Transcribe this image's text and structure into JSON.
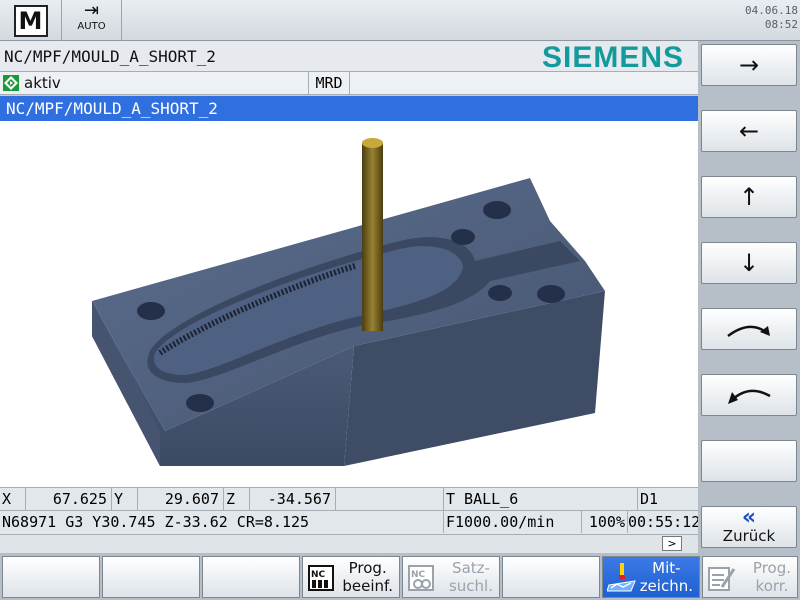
{
  "header": {
    "mode_jog_label": "M",
    "mode_auto_label": "AUTO",
    "date": "04.06.18",
    "time": "08:52"
  },
  "program": {
    "path": "NC/MPF/MOULD_A_SHORT_2",
    "brand": "SIEMENS",
    "status": "aktiv",
    "mrd": "MRD",
    "title": "NC/MPF/MOULD_A_SHORT_2"
  },
  "positions": {
    "x_label": "X",
    "x_value": "67.625",
    "y_label": "Y",
    "y_value": "29.607",
    "z_label": "Z",
    "z_value": "-34.567",
    "tool": "T BALL_6",
    "d": "D1"
  },
  "nc_line": {
    "block": "N68971 G3 Y30.745 Z-33.62 CR=8.125",
    "feed": "F1000.00/min",
    "override": "100%",
    "runtime": "00:55:12"
  },
  "scroll_glyph": ">",
  "right_softkeys": [
    {
      "label": "→"
    },
    {
      "label": "←"
    },
    {
      "label": "↑"
    },
    {
      "label": "↓"
    },
    {
      "label": ""
    },
    {
      "label": ""
    },
    {
      "label": ""
    },
    {
      "label": "«",
      "sub": "Zurück"
    }
  ],
  "bottom_softkeys": [
    {
      "l1": "",
      "l2": ""
    },
    {
      "l1": "",
      "l2": ""
    },
    {
      "l1": "",
      "l2": ""
    },
    {
      "l1": "Prog.",
      "l2": "beeinf."
    },
    {
      "l1": "Satz-",
      "l2": "suchl."
    },
    {
      "l1": "",
      "l2": ""
    },
    {
      "l1": "Mit-",
      "l2": "zeichn."
    },
    {
      "l1": "Prog.",
      "l2": "korr."
    }
  ],
  "colors": {
    "brand": "#139a9c",
    "selection_bar": "#2f6fe0",
    "part": "#4a5a78",
    "tool": "#6b5a1c"
  }
}
